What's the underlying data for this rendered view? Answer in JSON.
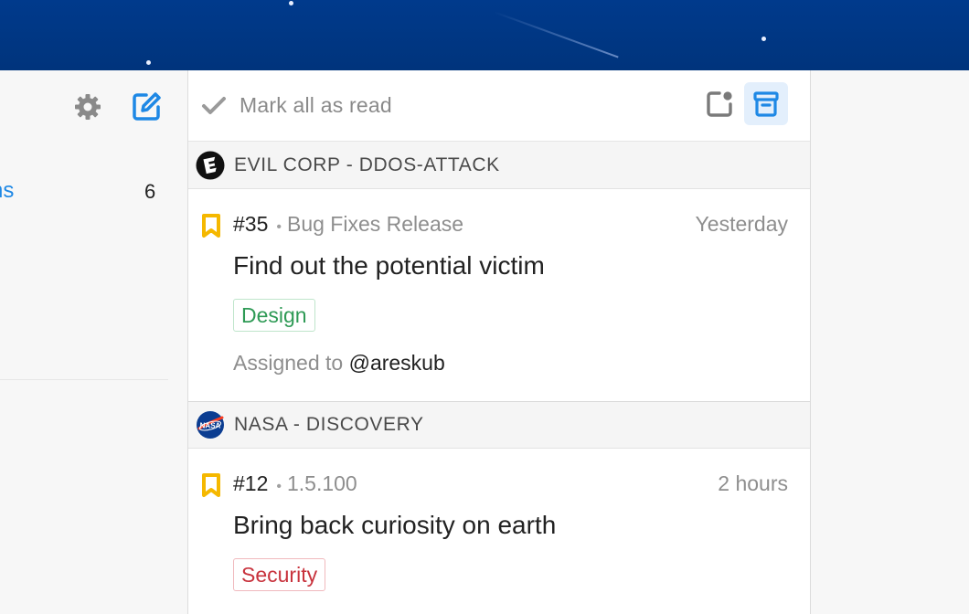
{
  "sidebar": {
    "link_fragment": "ns",
    "count": "6"
  },
  "toolbar": {
    "mark_all_label": "Mark all as read"
  },
  "groups": [
    {
      "name": "EVIL CORP - DDOS-ATTACK",
      "logo": "evil-corp-logo",
      "notification": {
        "number": "#35",
        "milestone": "Bug Fixes Release",
        "time": "Yesterday",
        "title": "Find out the potential victim",
        "tag": "Design",
        "tag_color": "#2e9a55",
        "assigned_prefix": "Assigned to",
        "assignee": "@areskub"
      }
    },
    {
      "name": "NASA - DISCOVERY",
      "logo": "nasa-logo",
      "notification": {
        "number": "#12",
        "milestone": "1.5.100",
        "time": "2 hours",
        "title": "Bring back curiosity on earth",
        "tag": "Security",
        "tag_color": "#c8333d"
      }
    }
  ],
  "colors": {
    "banner": "#003a8c",
    "accent": "#1e88e5",
    "bookmark": "#f5b800"
  }
}
